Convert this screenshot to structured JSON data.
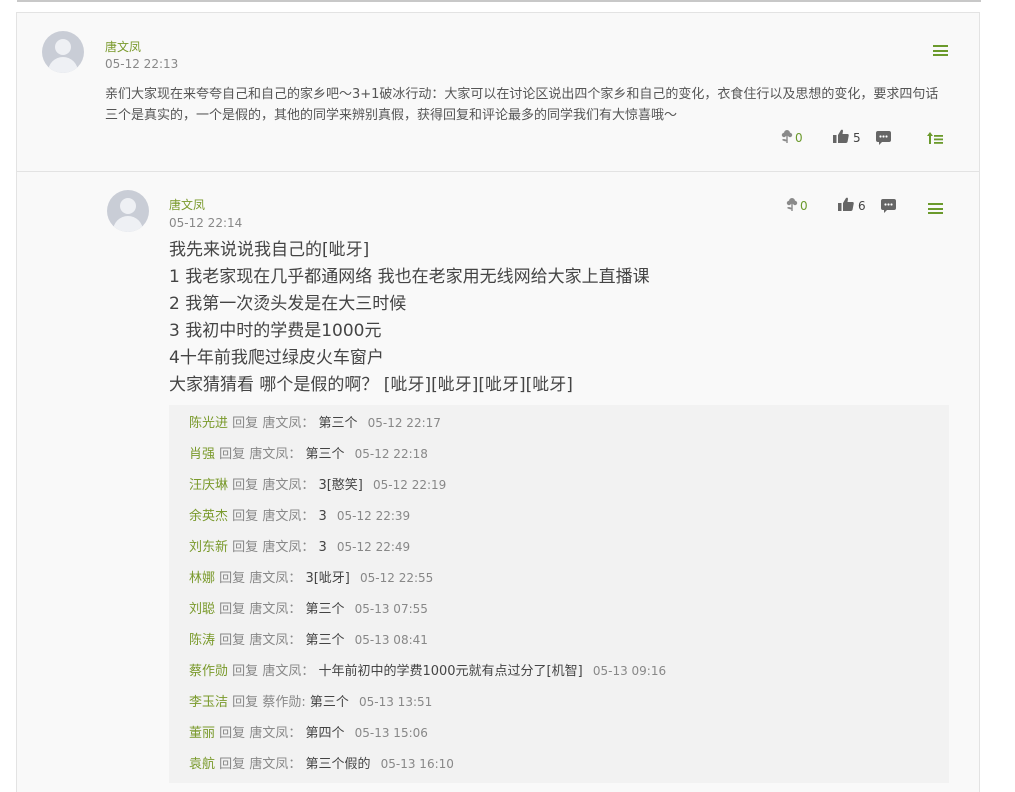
{
  "post": {
    "author": "唐文凤",
    "time": "05-12 22:13",
    "text": "亲们大家现在来夸夸自己和自己的家乡吧～3+1破冰行动：大家可以在讨论区说出四个家乡和自己的变化，衣食住行以及思想的变化，要求四句话三个是真实的，一个是假的，其他的同学来辨别真假，获得回复和评论最多的同学我们有大惊喜哦～",
    "flower_count": "0",
    "like_count": "5"
  },
  "reply": {
    "author": "唐文凤",
    "time": "05-12 22:14",
    "flower_count": "0",
    "like_count": "6",
    "lines": [
      "我先来说说我自己的[呲牙]",
      "1 我老家现在几乎都通网络 我也在老家用无线网给大家上直播课",
      "2 我第一次烫头发是在大三时候",
      "3 我初中时的学费是1000元",
      "4十年前我爬过绿皮火车窗户",
      "大家猜猜看 哪个是假的啊？ [呲牙][呲牙][呲牙][呲牙]"
    ]
  },
  "sub_replies": [
    {
      "name": "陈光进",
      "reply_word": "回复",
      "target": "唐文凤：",
      "text": "第三个",
      "time": "05-12 22:17"
    },
    {
      "name": "肖强",
      "reply_word": "回复",
      "target": "唐文凤：",
      "text": "第三个",
      "time": "05-12 22:18"
    },
    {
      "name": "汪庆琳",
      "reply_word": "回复",
      "target": "唐文凤：",
      "text": "3[憨笑]",
      "time": "05-12 22:19"
    },
    {
      "name": "余英杰",
      "reply_word": "回复",
      "target": "唐文凤：",
      "text": "3",
      "time": "05-12 22:39"
    },
    {
      "name": "刘东新",
      "reply_word": "回复",
      "target": "唐文凤：",
      "text": "3",
      "time": "05-12 22:49"
    },
    {
      "name": "林娜",
      "reply_word": "回复",
      "target": "唐文凤：",
      "text": "3[呲牙]",
      "time": "05-12 22:55"
    },
    {
      "name": "刘聪",
      "reply_word": "回复",
      "target": "唐文凤：",
      "text": "第三个",
      "time": "05-13 07:55"
    },
    {
      "name": "陈涛",
      "reply_word": "回复",
      "target": "唐文凤：",
      "text": "第三个",
      "time": "05-13 08:41"
    },
    {
      "name": "蔡作勋",
      "reply_word": "回复",
      "target": "唐文凤：",
      "text": "十年前初中的学费1000元就有点过分了[机智]",
      "time": "05-13 09:16"
    },
    {
      "name": "李玉洁",
      "reply_word": "回复",
      "target": "蔡作勋:",
      "text": "第三个",
      "time": "05-13 13:51"
    },
    {
      "name": "董丽",
      "reply_word": "回复",
      "target": "唐文凤：",
      "text": "第四个",
      "time": "05-13 15:06"
    },
    {
      "name": "袁航",
      "reply_word": "回复",
      "target": "唐文凤：",
      "text": "第三个假的",
      "time": "05-13 16:10"
    }
  ],
  "icons": {
    "flower": "flower-icon",
    "like": "thumbs-up-icon",
    "comment": "comment-icon",
    "menu": "menu-icon",
    "pin": "pin-top-icon"
  },
  "colors": {
    "accent": "#6b9a2c",
    "name": "#7a9a2c"
  }
}
